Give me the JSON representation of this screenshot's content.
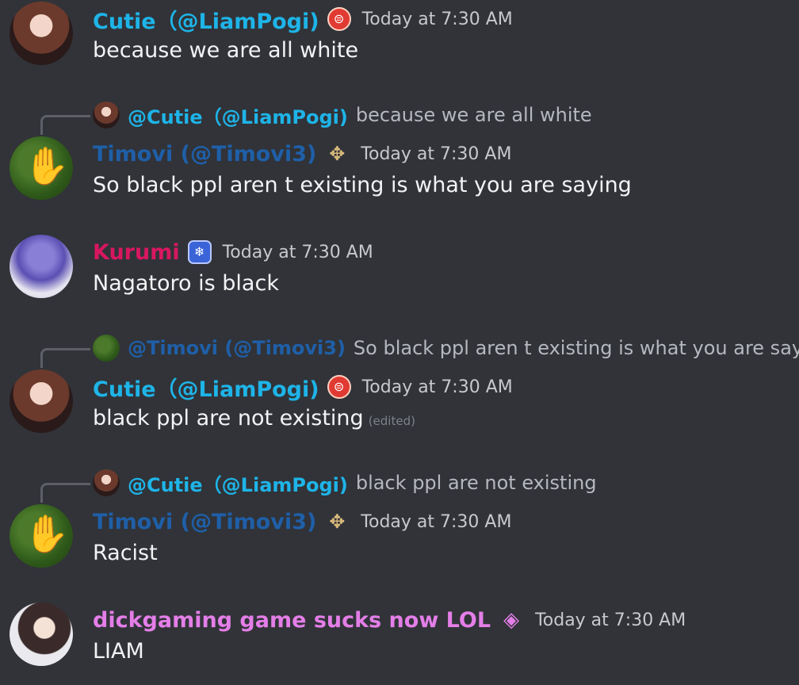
{
  "messages": [
    {
      "username": "Cutie（@LiamPogi)",
      "time": "Today at 7:30 AM",
      "text": "because we are all white"
    },
    {
      "reply_name": "@Cutie（@LiamPogi)",
      "reply_text": "because we are all white",
      "username": "Timovi (@Timovi3)",
      "time": "Today at 7:30 AM",
      "text": "So black ppl aren t existing is what you are saying"
    },
    {
      "username": "Kurumi",
      "time": "Today at 7:30 AM",
      "text": "Nagatoro is black"
    },
    {
      "reply_name": "@Timovi (@Timovi3)",
      "reply_text": "So black ppl aren t existing is what you are saying",
      "username": "Cutie（@LiamPogi)",
      "time": "Today at 7:30 AM",
      "text": "black ppl are not existing",
      "edited": "(edited)"
    },
    {
      "reply_name": "@Cutie（@LiamPogi)",
      "reply_text": "black ppl are not existing",
      "username": "Timovi (@Timovi3)",
      "time": "Today at 7:30 AM",
      "text": "Racist"
    },
    {
      "username": "dickgaming game sucks now LOL",
      "time": "Today at 7:30 AM",
      "text": "LIAM"
    }
  ],
  "colors": {
    "background": "#313338",
    "cutie": "#1eb4e8",
    "timovi": "#1f5fa8",
    "kurumi": "#d8175f",
    "dick": "#e47ee8"
  },
  "icons": {
    "cutie_badge": "red-circle-badge-icon",
    "timovi_badge": "winged-emblem-icon",
    "kurumi_badge": "blue-snowflake-badge-icon",
    "dick_badge": "purple-gem-badge-icon"
  }
}
